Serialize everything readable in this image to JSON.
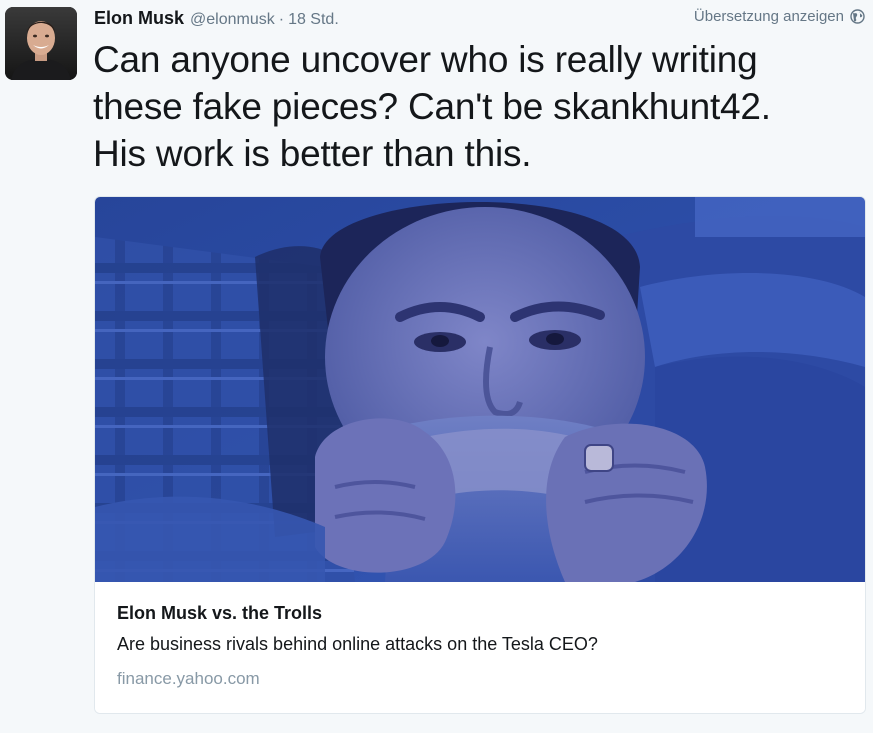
{
  "author": {
    "name": "Elon Musk",
    "handle": "@elonmusk",
    "separator": "·",
    "time": "18 Std."
  },
  "actions": {
    "translate_label": "Übersetzung anzeigen"
  },
  "tweet": {
    "lines": [
      "Can anyone uncover who is really writing",
      "these fake pieces? Can't be skankhunt42.",
      "His work is better than this."
    ]
  },
  "card": {
    "title": "Elon Musk vs. the Trolls",
    "description": "Are business rivals behind online attacks on the Tesla CEO?",
    "domain": "finance.yahoo.com"
  },
  "icons": {
    "globe": "globe-icon"
  },
  "colors": {
    "text_primary": "#14171a",
    "text_secondary": "#657786",
    "background": "#f5f8fa",
    "card_border": "#e1e8ed",
    "image_tint": "#2f4fa8"
  }
}
